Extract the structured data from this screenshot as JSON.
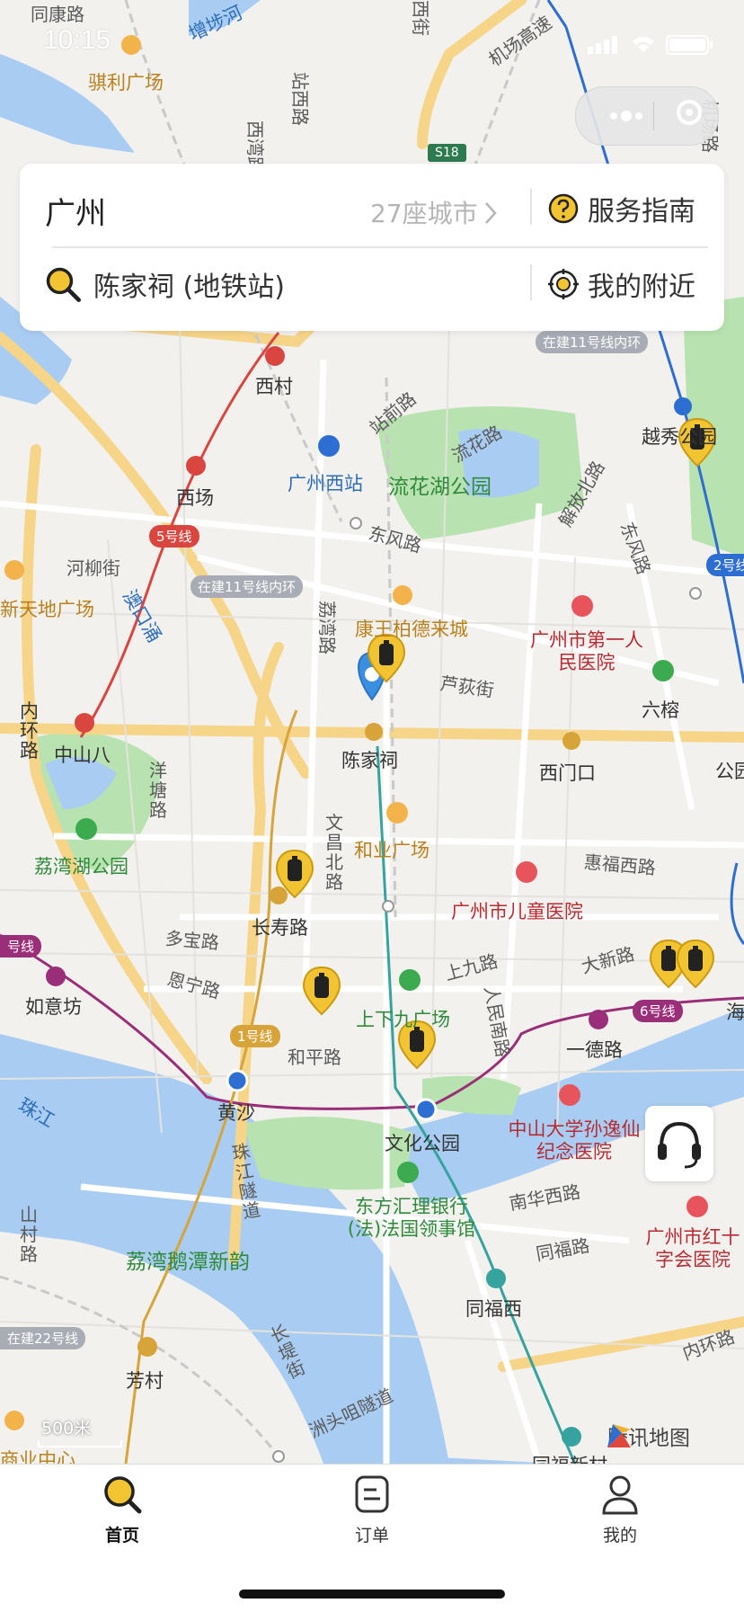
{
  "status_bar": {
    "time": "10:15"
  },
  "top_card": {
    "city": "广州",
    "city_count": "27座城市",
    "guide_label": "服务指南",
    "search_text": "陈家祠 (地铁站)",
    "nearby_label": "我的附近"
  },
  "map": {
    "labels": {
      "tongkang": "同康路",
      "zengbu": "增埗河",
      "jili": "骐利广场",
      "zhanxi": "站西路",
      "xiwan": "西湾路",
      "xijie": "西街",
      "airport_exp": "机场高速",
      "s18": "S18",
      "jichang": "机场路",
      "xicun": "西村",
      "zhanqian": "站前路",
      "liuhua_road": "流花路",
      "gz_west": "广州西站",
      "liuhua_park": "流花湖公园",
      "yuexiu": "越秀公园",
      "xichang": "西场",
      "dongfeng": "东风路",
      "dongfeng2": "东风路",
      "jiefang": "解放北路",
      "heliu": "河柳街",
      "yongkou": "澳口涌",
      "xintiandi": "新天地广场",
      "liwan": "荔湾路",
      "kangwang": "康王柏德来城",
      "hospital1": "广州市第一人民医院",
      "liurong": "六榕",
      "luhuo": "芦荻街",
      "neihuan": "内环路",
      "zhongshan8": "中山八",
      "chenjiaci": "陈家祠",
      "ximenkou": "西门口",
      "gongyuanqian": "公园前",
      "yangtang": "洋塘路",
      "wenchang": "文昌北路",
      "heye": "和业广场",
      "huifu": "惠福西路",
      "liwan_lake": "荔湾湖公园",
      "child_hosp": "广州市儿童医院",
      "changshou": "长寿路",
      "duobao": "多宝路",
      "enning": "恩宁路",
      "shangjiu": "上九路",
      "daxin": "大新路",
      "ruyifang": "如意坊",
      "shangxiajiu": "上下九广场",
      "renmin": "人民南路",
      "yide": "一德路",
      "hai": "海",
      "heping": "和平路",
      "zhujiang": "珠江",
      "huangsha": "黄沙",
      "wenhua": "文化公园",
      "sunyatsen": "中山大学孙逸仙纪念医院",
      "zhujiang_tunnel": "珠江隧道",
      "hsbc": "东方汇理银行(法)法国领事馆",
      "nanhua": "南华西路",
      "redcross": "广州市红十字会医院",
      "shancun": "山村路",
      "pengtan": "荔湾鹅潭新韵",
      "tongfu": "同福路",
      "tongfuxi": "同福西",
      "fangcun": "芳村",
      "changti": "长堤街",
      "zhoutou": "洲头咀隧道",
      "neihuan2": "内环路",
      "shangye": "商业中心",
      "tongfuxin": "同福新村"
    },
    "chips": {
      "line11a": "在建11号线内环",
      "line11b": "在建11号线内环",
      "line5": "5号线",
      "line2": "2号线",
      "line6": "6号线",
      "line1": "1号线",
      "line22": "在建22号线",
      "line6b": "号线"
    },
    "scale": "500米",
    "provider": "腾讯地图"
  },
  "tabbar": {
    "tabs": [
      {
        "label": "首页",
        "icon": "search-icon",
        "active": true
      },
      {
        "label": "订单",
        "icon": "order-icon",
        "active": false
      },
      {
        "label": "我的",
        "icon": "user-icon",
        "active": false
      }
    ]
  },
  "colors": {
    "accent": "#f3c431",
    "metro_red": "#d9463f",
    "metro_purple": "#9b2e78",
    "metro_gold": "#d7a43a",
    "water": "#a9cdf2",
    "park": "#b8e3b0"
  }
}
